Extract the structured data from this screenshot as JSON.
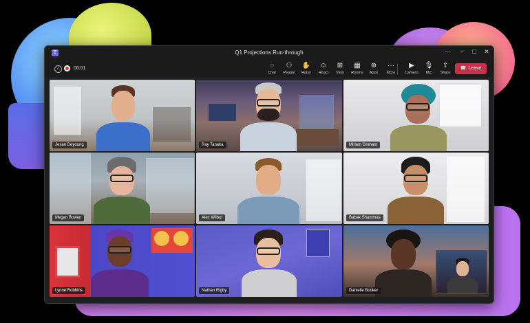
{
  "window": {
    "title": "Q1 Projections Run-through",
    "controls": {
      "more": "···",
      "minimize": "–",
      "maximize": "□",
      "close": "✕"
    }
  },
  "toolbar": {
    "timer": "00:01",
    "buttons": [
      {
        "icon": "chat-icon",
        "label": "Chat"
      },
      {
        "icon": "people-icon",
        "label": "People"
      },
      {
        "icon": "raise-hand-icon",
        "label": "Raise"
      },
      {
        "icon": "react-icon",
        "label": "React"
      },
      {
        "icon": "view-icon",
        "label": "View"
      },
      {
        "icon": "rooms-icon",
        "label": "Rooms"
      },
      {
        "icon": "apps-icon",
        "label": "Apps"
      },
      {
        "icon": "more-icon",
        "label": "More"
      },
      {
        "icon": "camera-icon",
        "label": "Camera"
      },
      {
        "icon": "mic-icon",
        "label": "Mic"
      },
      {
        "icon": "share-icon",
        "label": "Share"
      }
    ],
    "leave_label": "Leave"
  },
  "participants": [
    {
      "name": "Jesan Deyoung"
    },
    {
      "name": "Ray Tanaka"
    },
    {
      "name": "Miriam Graham"
    },
    {
      "name": "Megan Bowen"
    },
    {
      "name": "Alex Wilbur"
    },
    {
      "name": "Babak Shammas"
    },
    {
      "name": "Lynne Robbins"
    },
    {
      "name": "Nathan Rigby"
    },
    {
      "name": "Danielle Booker"
    }
  ],
  "colors": {
    "leave": "#c4314b",
    "window_bg": "#1f1f1f",
    "accent": "#6a6ed8"
  }
}
